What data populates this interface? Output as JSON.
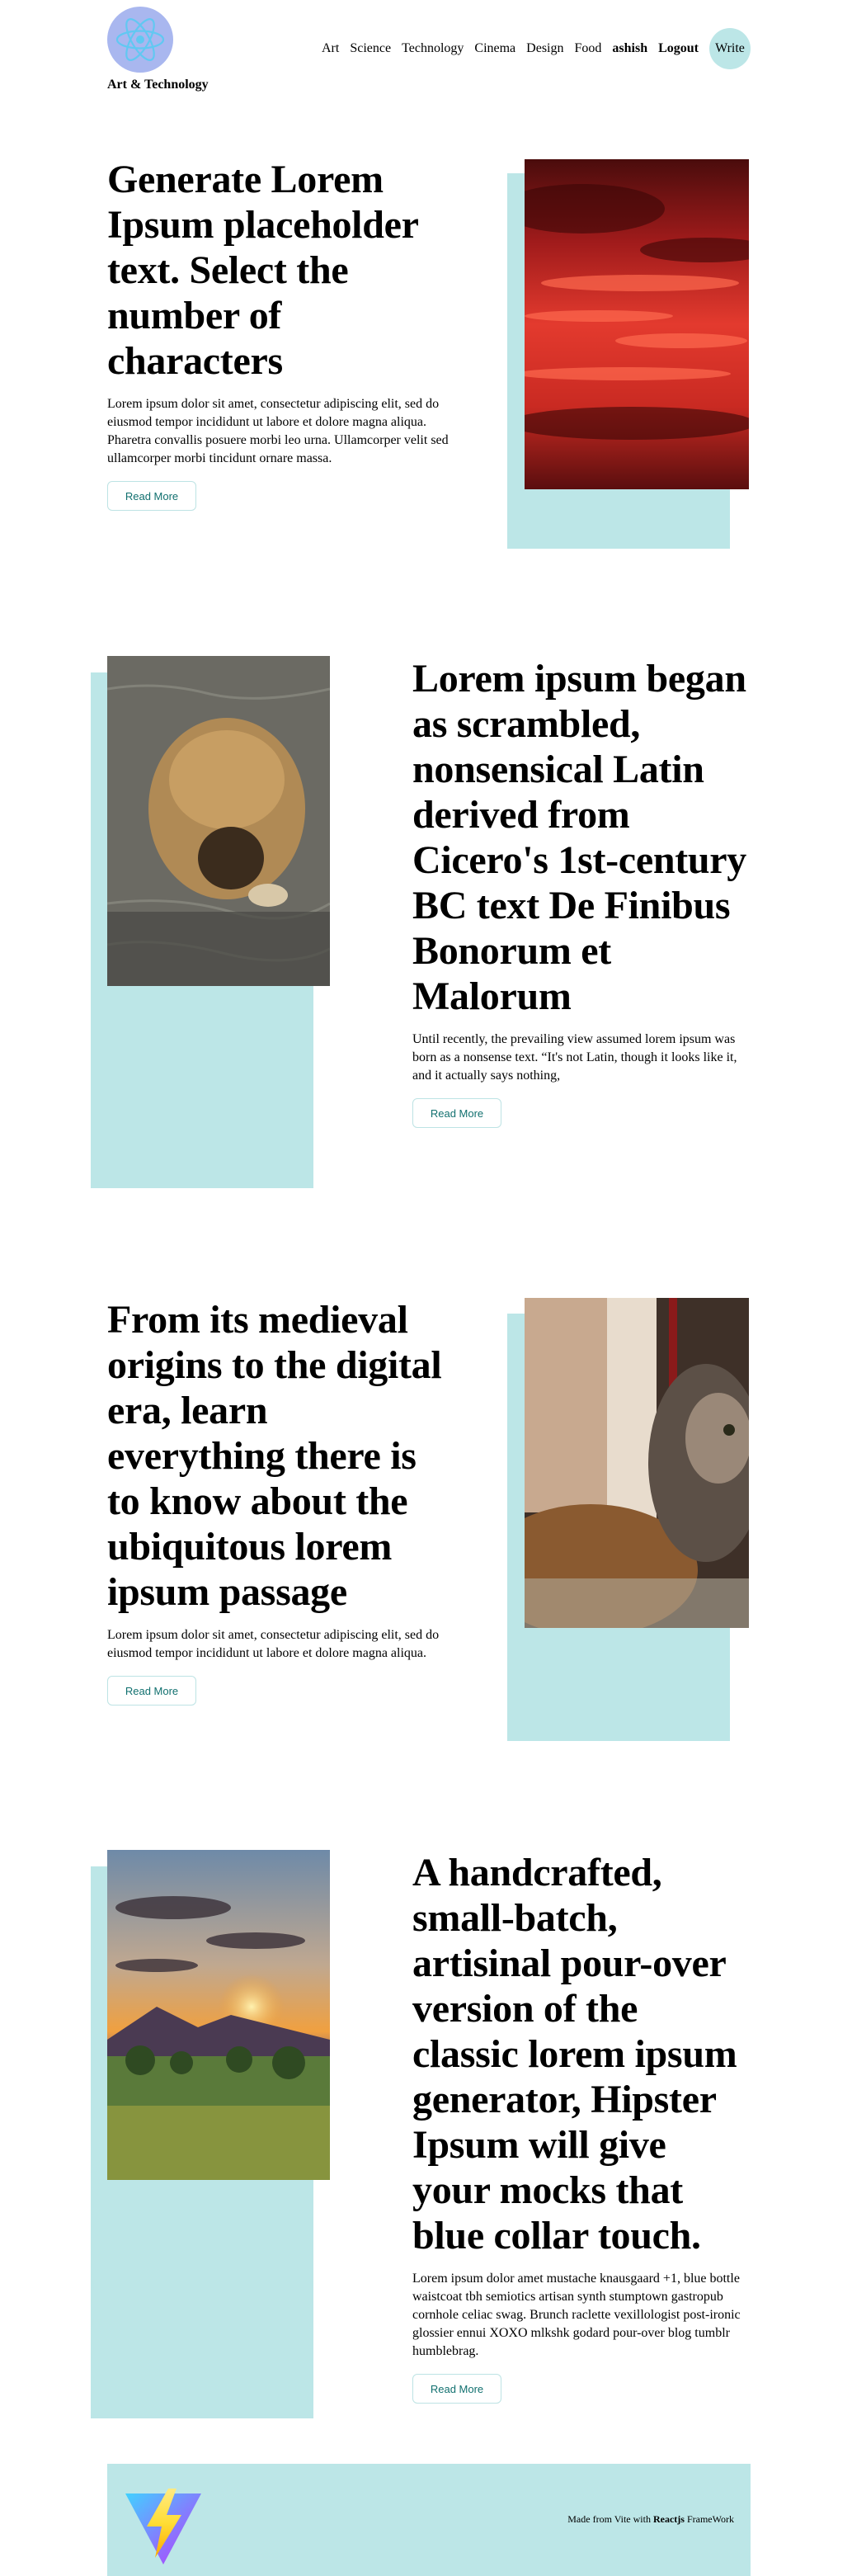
{
  "header": {
    "brand": "Art & Technology",
    "nav_links": [
      "Art",
      "Science",
      "Technology",
      "Cinema",
      "Design",
      "Food"
    ],
    "user_name": "ashish",
    "logout_label": "Logout",
    "write_label": "Write"
  },
  "posts": [
    {
      "title": "Generate Lorem Ipsum placeholder text. Select the number of characters",
      "body": "Lorem ipsum dolor sit amet, consectetur adipiscing elit, sed do eiusmod tempor incididunt ut labore et dolore magna aliqua. Pharetra convallis posuere morbi leo urna. Ullamcorper velit sed ullamcorper morbi tincidunt ornare massa.",
      "button": "Read More",
      "image": "red-sunset-clouds"
    },
    {
      "title": "Lorem ipsum began as scrambled, nonsensical Latin derived from Cicero's 1st-century BC text De Finibus Bonorum et Malorum",
      "body": "Until recently, the prevailing view assumed lorem ipsum was born as a nonsense text. “It's not Latin, though it looks like it, and it actually says nothing,",
      "button": "Read More",
      "image": "bear-in-water"
    },
    {
      "title": "From its medieval origins to the digital era, learn everything there is to know about the ubiquitous lorem ipsum passage",
      "body": "Lorem ipsum dolor sit amet, consectetur adipiscing elit, sed do eiusmod tempor incididunt ut labore et dolore magna aliqua.",
      "button": "Read More",
      "image": "cat-close-up"
    },
    {
      "title": "A handcrafted, small-batch, artisinal pour-over version of the classic lorem ipsum generator, Hipster Ipsum will give your mocks that blue collar touch.",
      "body": "Lorem ipsum dolor amet mustache knausgaard +1, blue bottle waistcoat tbh semiotics artisan synth stumptown gastropub cornhole celiac swag. Brunch raclette vexillologist post-ironic glossier ennui XOXO mlkshk godard pour-over blog tumblr humblebrag.",
      "button": "Read More",
      "image": "mountain-sunset"
    }
  ],
  "footer": {
    "text_prefix": "Made from Vite with ",
    "text_bold": "Reactjs",
    "text_suffix": " FrameWork",
    "logo": "vite-logo"
  },
  "colors": {
    "accent": "#bce6e7",
    "button_text": "#11706f",
    "logo_bg": "#a9b7ef"
  }
}
